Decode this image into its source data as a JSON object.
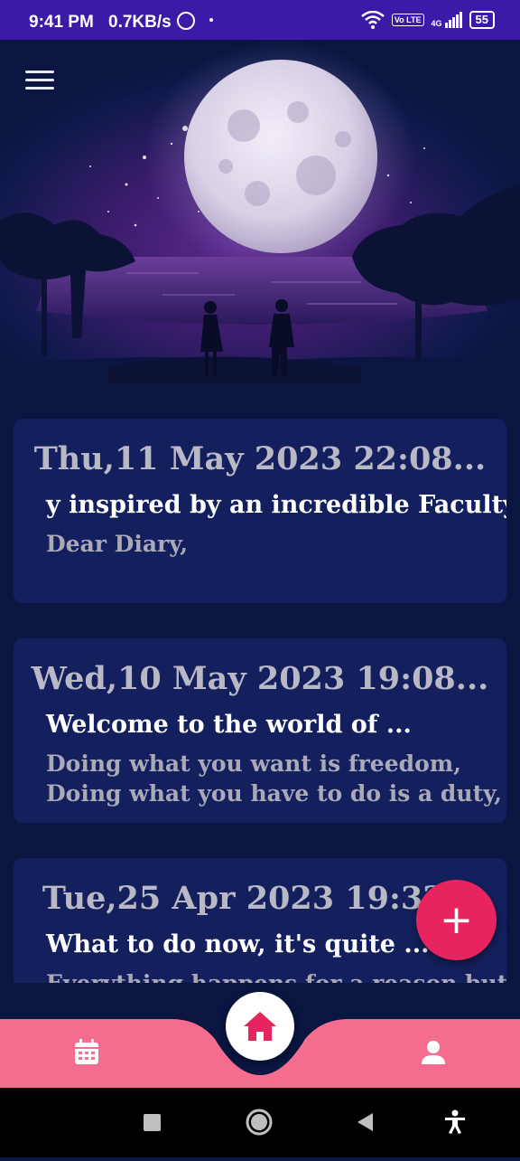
{
  "status_bar": {
    "time": "9:41 PM",
    "speed": "0.7KB/s",
    "volte": "Vo LTE",
    "network": "4G",
    "battery": "55"
  },
  "entries": [
    {
      "date": "Thu,11 May 2023  22:08...",
      "title": "y inspired by an incredible Faculty",
      "body": "Dear Diary,"
    },
    {
      "date": "Wed,10 May 2023 19:08...",
      "title": "Welcome to the world of ...",
      "body": "Doing what you want is freedom,\nDoing what you have to do is a duty,"
    },
    {
      "date": "Tue,25 Apr 2023 19:32...",
      "title": "What to do now, it's quite ...",
      "body": "Everything happens for a reason but"
    }
  ],
  "fab": {
    "label": "+"
  },
  "colors": {
    "background": "#0a1540",
    "card": "#14205e",
    "status_bar": "#3a1aa6",
    "accent": "#e8245e",
    "nav_bar": "#f46d8e"
  },
  "icons": {
    "menu": "hamburger-menu-icon",
    "calendar": "calendar-icon",
    "home": "home-icon",
    "profile": "person-icon",
    "add": "plus-icon"
  }
}
